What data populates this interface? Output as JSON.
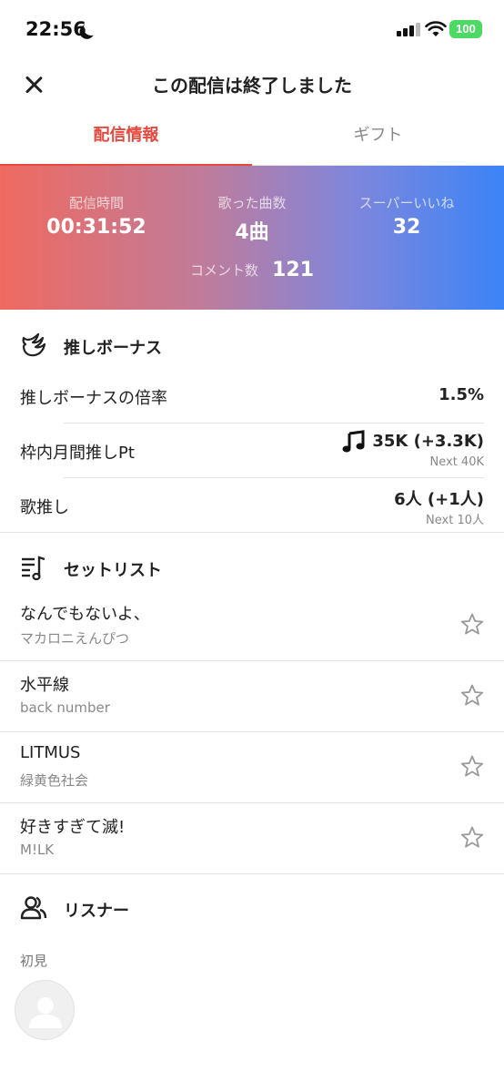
{
  "status_bar": {
    "time": "22:56",
    "battery": "100",
    "icons": [
      "moon-icon",
      "signal-icon",
      "wifi-icon",
      "battery-icon"
    ]
  },
  "header": {
    "title": "この配信は終了しました",
    "close_icon": "close-icon"
  },
  "tabs": [
    {
      "label": "配信情報",
      "active": true
    },
    {
      "label": "ギフト",
      "active": false
    }
  ],
  "stats": {
    "duration": {
      "label": "配信時間",
      "value": "00:31:52"
    },
    "songs": {
      "label": "歌った曲数",
      "value": "4曲"
    },
    "super_likes": {
      "label": "スーパーいいね",
      "value": "32"
    },
    "comments": {
      "label": "コメント数",
      "value": "121"
    }
  },
  "bonus": {
    "title": "推しボーナス",
    "rows": [
      {
        "label": "推しボーナスの倍率",
        "value": "1.5%",
        "sub": ""
      },
      {
        "label": "枠内月間推しPt",
        "value": "35K (+3.3K)",
        "sub": "Next 40K"
      },
      {
        "label": "歌推し",
        "value": "6人 (+1人)",
        "sub": "Next 10人"
      }
    ]
  },
  "setlist": {
    "title": "セットリスト",
    "songs": [
      {
        "title": "なんでもないよ、",
        "artist": "マカロニえんぴつ"
      },
      {
        "title": "水平線",
        "artist": "back number"
      },
      {
        "title": "LITMUS",
        "artist": "緑黄色社会"
      },
      {
        "title": "好きすぎて滅!",
        "artist": "M!LK"
      }
    ]
  },
  "listeners": {
    "title": "リスナー",
    "group_label": "初見"
  },
  "colors": {
    "accent": "#e8493f",
    "gradient_start": "#ef6a60",
    "gradient_end": "#3b84f7"
  }
}
